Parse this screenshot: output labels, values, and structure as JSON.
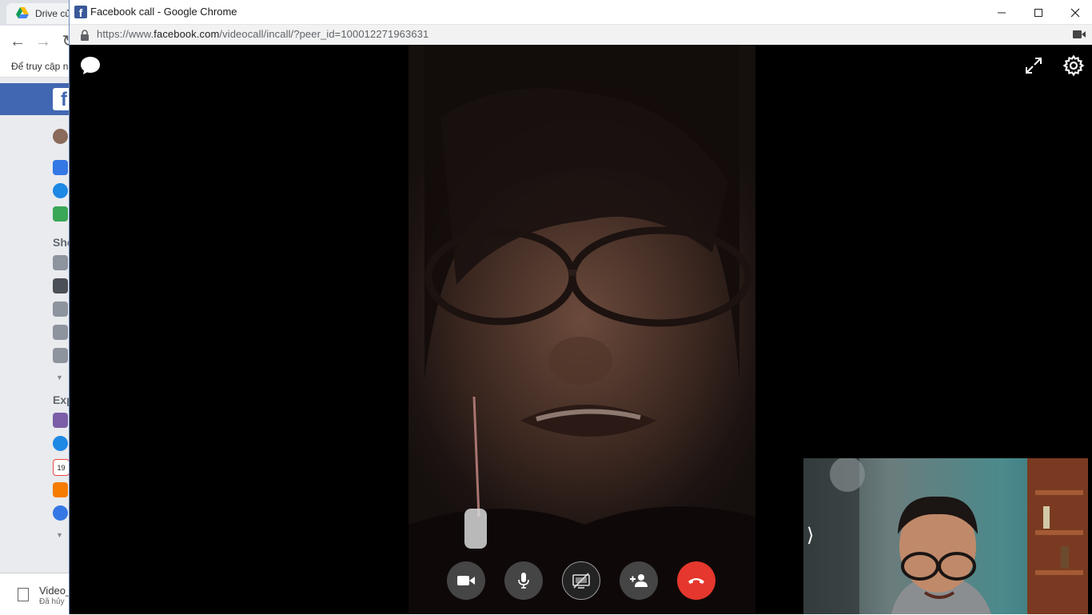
{
  "background_window": {
    "tab_title": "Drive củ",
    "bookmarks_text": "Để truy cập n",
    "fb_logo": "f",
    "sidebar_sections": [
      "Sho",
      "Exp"
    ],
    "download": {
      "name": "Video_",
      "status": "Đã hủy"
    },
    "calendar_day": "19"
  },
  "window": {
    "title": "Facebook call - Google Chrome",
    "favicon": "f",
    "url_prefix": "https://www.",
    "url_domain": "facebook.com",
    "url_path": "/videocall/incall/?peer_id=100012271963631"
  },
  "call": {
    "controls": [
      {
        "name": "video-camera-button",
        "icon": "video-camera-icon"
      },
      {
        "name": "microphone-button",
        "icon": "microphone-icon"
      },
      {
        "name": "screen-share-button",
        "icon": "screen-share-off-icon"
      },
      {
        "name": "add-person-button",
        "icon": "add-person-icon"
      },
      {
        "name": "end-call-button",
        "icon": "hang-up-icon"
      }
    ],
    "self_view_toggle": "⟩"
  },
  "colors": {
    "end_call": "#e5372d",
    "facebook_blue": "#4267b2",
    "control_bg": "#505050"
  }
}
